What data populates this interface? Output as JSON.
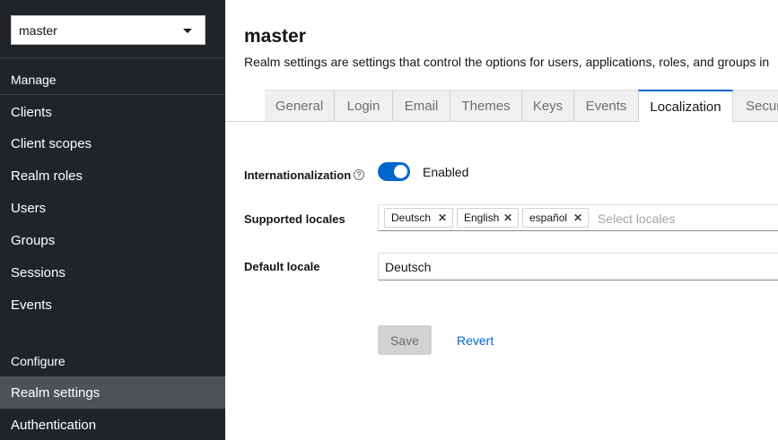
{
  "sidebar": {
    "realm_selector": {
      "value": "master"
    },
    "manage_heading": "Manage",
    "manage_items": [
      {
        "label": "Clients"
      },
      {
        "label": "Client scopes"
      },
      {
        "label": "Realm roles"
      },
      {
        "label": "Users"
      },
      {
        "label": "Groups"
      },
      {
        "label": "Sessions"
      },
      {
        "label": "Events"
      }
    ],
    "configure_heading": "Configure",
    "configure_items": [
      {
        "label": "Realm settings",
        "active": true
      },
      {
        "label": "Authentication"
      }
    ]
  },
  "main": {
    "title": "master",
    "description": "Realm settings are settings that control the options for users, applications, roles, and groups in",
    "tabs": [
      {
        "label": "General"
      },
      {
        "label": "Login"
      },
      {
        "label": "Email"
      },
      {
        "label": "Themes"
      },
      {
        "label": "Keys"
      },
      {
        "label": "Events"
      },
      {
        "label": "Localization",
        "active": true
      },
      {
        "label": "Secur"
      }
    ],
    "form": {
      "internationalization": {
        "label": "Internationalization",
        "enabled": true,
        "state_label": "Enabled"
      },
      "supported_locales": {
        "label": "Supported locales",
        "chips": [
          {
            "label": "Deutsch"
          },
          {
            "label": "English"
          },
          {
            "label": "español"
          }
        ],
        "placeholder": "Select locales"
      },
      "default_locale": {
        "label": "Default locale",
        "value": "Deutsch"
      }
    },
    "actions": {
      "save_label": "Save",
      "revert_label": "Revert"
    }
  },
  "icons": {
    "help": "help-circle-icon",
    "chip_remove": "close-icon",
    "dropdown": "caret-down-icon"
  },
  "colors": {
    "accent": "#0066cc",
    "sidebar_bg": "#212427",
    "sidebar_active": "#4f5255"
  }
}
